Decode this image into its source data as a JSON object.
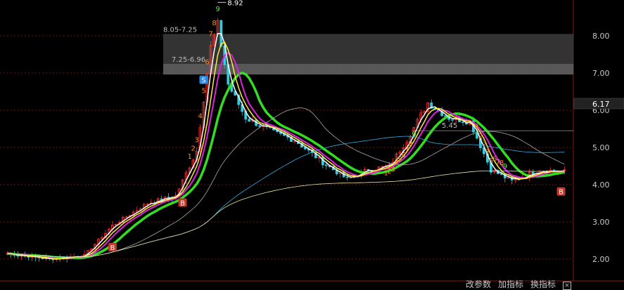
{
  "chart_data": {
    "type": "candlestick",
    "y_axis": {
      "ticks": [
        "8.00",
        "7.00",
        "6.00",
        "5.00",
        "4.00",
        "3.00",
        "2.00"
      ],
      "ylim": [
        1.7,
        8.95
      ],
      "side": "right"
    },
    "price_tag": "6.17",
    "max_label": "8.92",
    "zones": [
      {
        "label": "8.05-7.25",
        "low": 7.25,
        "high": 8.05
      },
      {
        "label": "7.25-6.96",
        "low": 6.96,
        "high": 7.25
      }
    ],
    "level_label": "5.45",
    "reference_lines": [
      {
        "value": 5.45
      }
    ],
    "buy_signal": "B",
    "sell_signal": "S",
    "count_labels": [
      "1",
      "2",
      "3",
      "4",
      "5",
      "6",
      "7",
      "8",
      "9"
    ],
    "series": [
      {
        "key": "trend",
        "color": "#33dd22",
        "width": 3.5
      },
      {
        "key": "ma_magenta",
        "color": "#dd22dd",
        "width": 2
      },
      {
        "key": "ma_white",
        "color": "#ffffff",
        "width": 1.5
      },
      {
        "key": "ma_yellow",
        "color": "#ffee33",
        "width": 1.5
      },
      {
        "key": "ma_grey",
        "color": "#aaaaaa",
        "width": 0.8
      },
      {
        "key": "ma_blue",
        "color": "#33aadd",
        "width": 0.8
      },
      {
        "key": "ma_long",
        "color": "#e8e4a0",
        "width": 0.8
      }
    ],
    "colors": {
      "up": "#ff3333",
      "down": "#33ccdd",
      "background": "#000000",
      "grid": "#7a1010",
      "count": "#ff8c1a",
      "count_nine": "#33ff33"
    }
  },
  "toolbar": {
    "params_label": "改参数",
    "add_label": "加指标",
    "switch_label": "换指标",
    "close_label": "×"
  }
}
